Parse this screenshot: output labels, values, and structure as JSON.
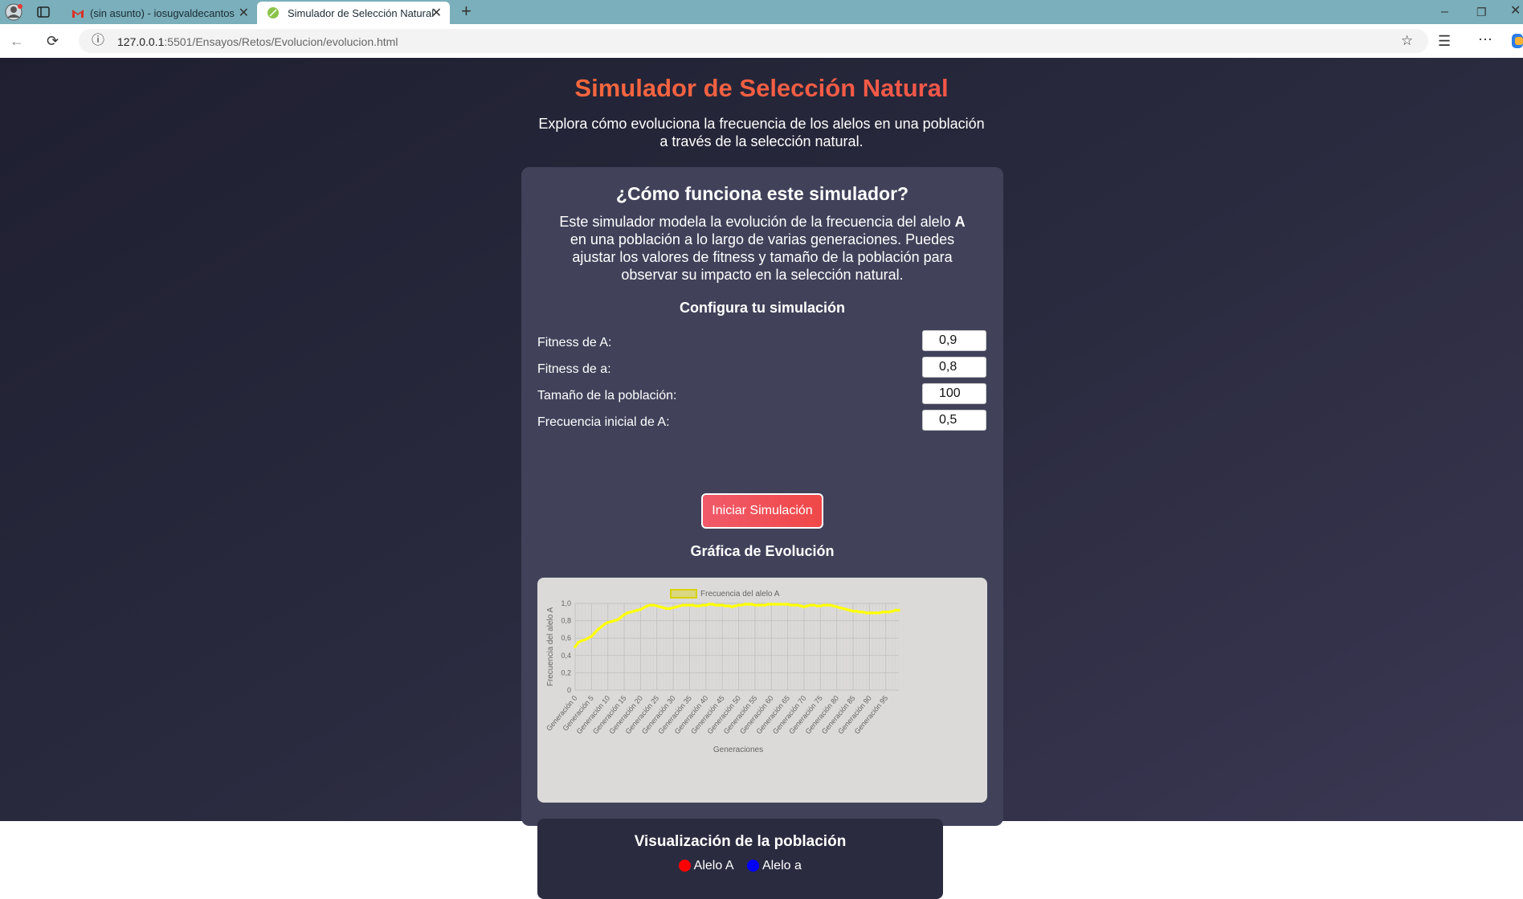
{
  "browser": {
    "tabs": [
      {
        "title": "(sin asunto) - iosugvaldecantos@",
        "icon": "gmail-icon",
        "active": false
      },
      {
        "title": "Simulador de Selección Natural",
        "icon": "leaf-icon",
        "active": true
      }
    ],
    "url_host": "127.0.0.1",
    "url_path": ":5501/Ensayos/Retos/Evolucion/evolucion.html"
  },
  "page": {
    "title": "Simulador de Selección Natural",
    "subtitle_line1": "Explora cómo evoluciona la frecuencia de los alelos en una población",
    "subtitle_line2": "a través de la selección natural.",
    "how_title": "¿Cómo funciona este simulador?",
    "desc_line1_a": "Este simulador modela la evolución de la frecuencia del alelo ",
    "desc_line1_b": "A",
    "desc_line2": "en una población a lo largo de varias generaciones. Puedes",
    "desc_line3": "ajustar los valores de fitness y tamaño de la población para",
    "desc_line4": "observar su impacto en la selección natural.",
    "config_title": "Configura tu simulación",
    "fields": [
      {
        "label": "Fitness de A:",
        "value": "0,9"
      },
      {
        "label": "Fitness de a:",
        "value": "0,8"
      },
      {
        "label": "Tamaño de la población:",
        "value": "100"
      },
      {
        "label": "Frecuencia inicial de A:",
        "value": "0,5"
      }
    ],
    "start_button": "Iniciar Simulación",
    "chart_title": "Gráfica de Evolución",
    "population_title": "Visualización de la población",
    "legend_A": "Alelo A",
    "legend_a": "Alelo a",
    "colors": {
      "alelo_A": "#ff0000",
      "alelo_a": "#0000ff",
      "line": "#ffff00",
      "accent": "#f05a5a"
    }
  },
  "chart_data": {
    "type": "line",
    "legend": "Frecuencia del alelo A",
    "xlabel": "Generaciones",
    "ylabel": "Frecuencia del alelo A",
    "ylim": [
      0,
      1
    ],
    "yticks": [
      "0",
      "0,2",
      "0,4",
      "0,6",
      "0,8",
      "1,0"
    ],
    "xtick_labels": [
      "Generación 0",
      "Generación 5",
      "Generación 10",
      "Generación 15",
      "Generación 20",
      "Generación 25",
      "Generación 30",
      "Generación 35",
      "Generación 40",
      "Generación 45",
      "Generación 50",
      "Generación 55",
      "Generación 60",
      "Generación 65",
      "Generación 70",
      "Generación 75",
      "Generación 80",
      "Generación 85",
      "Generación 90",
      "Generación 95"
    ],
    "x": [
      0,
      1,
      2,
      3,
      4,
      5,
      6,
      7,
      8,
      9,
      10,
      11,
      12,
      13,
      14,
      15,
      16,
      17,
      18,
      19,
      20,
      21,
      22,
      23,
      24,
      25,
      26,
      27,
      28,
      29,
      30,
      31,
      32,
      33,
      34,
      35,
      36,
      37,
      38,
      39,
      40,
      41,
      42,
      43,
      44,
      45,
      46,
      47,
      48,
      49,
      50,
      51,
      52,
      53,
      54,
      55,
      56,
      57,
      58,
      59,
      60,
      61,
      62,
      63,
      64,
      65,
      66,
      67,
      68,
      69,
      70,
      71,
      72,
      73,
      74,
      75,
      76,
      77,
      78,
      79,
      80,
      81,
      82,
      83,
      84,
      85,
      86,
      87,
      88,
      89,
      90,
      91,
      92,
      93,
      94,
      95,
      96,
      97,
      98,
      99
    ],
    "values": [
      0.5,
      0.55,
      0.57,
      0.58,
      0.6,
      0.62,
      0.66,
      0.7,
      0.73,
      0.76,
      0.78,
      0.79,
      0.8,
      0.81,
      0.84,
      0.87,
      0.89,
      0.9,
      0.91,
      0.92,
      0.93,
      0.95,
      0.97,
      0.98,
      0.98,
      0.97,
      0.96,
      0.95,
      0.94,
      0.94,
      0.95,
      0.96,
      0.97,
      0.98,
      0.98,
      0.98,
      0.98,
      0.97,
      0.97,
      0.98,
      0.98,
      0.99,
      0.99,
      0.98,
      0.98,
      0.98,
      0.97,
      0.97,
      0.96,
      0.97,
      0.98,
      0.98,
      0.99,
      0.99,
      0.99,
      0.98,
      0.98,
      0.98,
      0.98,
      0.99,
      0.99,
      0.99,
      0.99,
      0.99,
      0.99,
      0.99,
      0.98,
      0.98,
      0.98,
      0.97,
      0.96,
      0.97,
      0.98,
      0.98,
      0.97,
      0.97,
      0.98,
      0.98,
      0.98,
      0.97,
      0.96,
      0.95,
      0.94,
      0.93,
      0.92,
      0.91,
      0.91,
      0.9,
      0.9,
      0.89,
      0.89,
      0.89,
      0.89,
      0.89,
      0.9,
      0.9,
      0.9,
      0.91,
      0.92,
      0.92
    ]
  }
}
